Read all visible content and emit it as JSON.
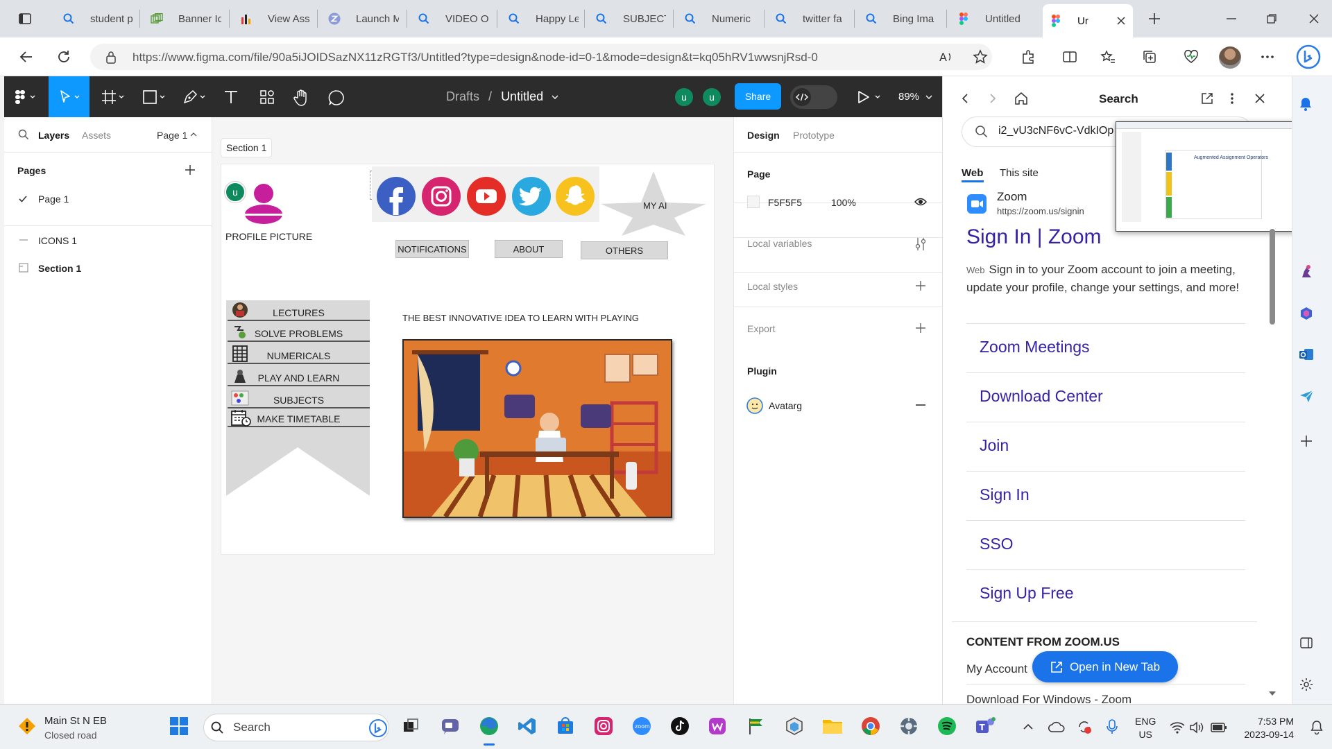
{
  "browser": {
    "tabs": [
      {
        "label": "student p",
        "icon": "search-icon"
      },
      {
        "label": "Banner Ic",
        "icon": "banner-icon"
      },
      {
        "label": "View Ass",
        "icon": "chart-icon"
      },
      {
        "label": "Launch M",
        "icon": "z-icon"
      },
      {
        "label": "VIDEO O",
        "icon": "search-icon"
      },
      {
        "label": "Happy Le",
        "icon": "search-icon"
      },
      {
        "label": "SUBJECTS",
        "icon": "search-icon"
      },
      {
        "label": "Numeric",
        "icon": "search-icon"
      },
      {
        "label": "twitter fa",
        "icon": "search-icon"
      },
      {
        "label": "Bing Ima",
        "icon": "search-icon"
      },
      {
        "label": "Untitled",
        "icon": "figma-icon"
      },
      {
        "label": "Ur",
        "icon": "figma-icon"
      }
    ],
    "url": "https://www.figma.com/file/90a5iJOIDSazNX11zRGTf3/Untitled?type=design&node-id=0-1&mode=design&t=kq05hRV1wwsnjRsd-0"
  },
  "figma": {
    "breadcrumb_drafts": "Drafts",
    "breadcrumb_sep": "/",
    "file_name": "Untitled",
    "avatar_initial": "u",
    "share_label": "Share",
    "zoom_level": "89%",
    "left_panel": {
      "tab_layers": "Layers",
      "tab_assets": "Assets",
      "page_selector": "Page 1",
      "pages_heading": "Pages",
      "pages": [
        "Page 1"
      ],
      "layers": [
        "ICONS 1",
        "Section 1"
      ]
    },
    "right_panel": {
      "tab_design": "Design",
      "tab_prototype": "Prototype",
      "page_heading": "Page",
      "page_color": "F5F5F5",
      "page_opacity": "100%",
      "local_variables": "Local variables",
      "local_styles": "Local styles",
      "export": "Export",
      "plugin_heading": "Plugin",
      "plugin_name": "Avatarg"
    },
    "canvas": {
      "section_label": "Section 1",
      "profile_label": "PROFILE PICTURE",
      "avatar_initial": "u",
      "my_ai": "MY AI",
      "nav_notifications": "NOTIFICATIONS",
      "nav_about": "ABOUT",
      "nav_others": "OTHERS",
      "menu": [
        "LECTURES",
        "SOLVE PROBLEMS",
        "NUMERICALS",
        "PLAY AND LEARN",
        "SUBJECTS",
        "MAKE TIMETABLE"
      ],
      "tagline": "THE BEST INNOVATIVE IDEA TO LEARN WITH PLAYING",
      "help": "?"
    }
  },
  "sidebar": {
    "title": "Search",
    "search_value": "i2_vU3cNF6vC-VdkIOp",
    "tab_web": "Web",
    "tab_site": "This site",
    "result_site_name": "Zoom",
    "result_site_url": "https://zoom.us/signin",
    "result_title": "Sign In | Zoom",
    "result_tag": "Web",
    "result_snippet": "Sign in to your Zoom account to join a meeting, update your profile, change your settings, and more!",
    "links": [
      "Zoom Meetings",
      "Download Center",
      "Join",
      "Sign In",
      "SSO",
      "Sign Up Free"
    ],
    "content_heading": "CONTENT FROM ZOOM.US",
    "my_account": "My Account",
    "open_new_tab": "Open in New Tab",
    "download_windows": "Download For Windows - Zoom",
    "thumbnail_title": "Augmented Assignment Operators"
  },
  "taskbar": {
    "traffic_title": "Main St N EB",
    "traffic_status": "Closed road",
    "search_placeholder": "Search",
    "lang_top": "ENG",
    "lang_bottom": "US",
    "time": "7:53 PM",
    "date": "2023-09-14"
  },
  "colors": {
    "figma_dark": "#2c2c2c",
    "figma_blue": "#0d99ff",
    "avatar_teal": "#0f8a5f",
    "link_purple": "#3722a6",
    "edge_blue": "#1a73e8"
  }
}
